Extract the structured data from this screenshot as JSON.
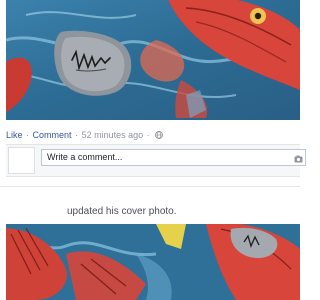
{
  "post": {
    "photo_alt": "photo",
    "actions": {
      "like": "Like",
      "comment": "Comment",
      "timestamp": "52 minutes ago",
      "separator": "·",
      "privacy_icon": "globe-icon"
    },
    "comment_box": {
      "placeholder": "Write a comment...",
      "camera_icon": "camera-icon"
    }
  },
  "next_story": {
    "text": "updated his cover photo.",
    "photo_alt": "cover photo"
  },
  "colors": {
    "link": "#365899",
    "meta": "#90949c",
    "input_border": "#bdc7d8",
    "tattoo_blue": "#2d6f97",
    "koi_red": "#d8453a"
  }
}
